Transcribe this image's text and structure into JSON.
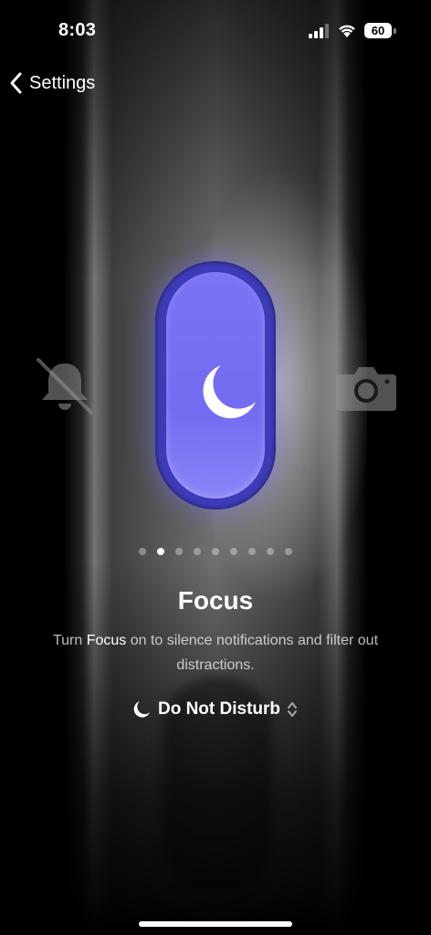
{
  "status_bar": {
    "time": "8:03",
    "battery_level": "60"
  },
  "nav": {
    "back_label": "Settings"
  },
  "action_button": {
    "left_icon": "bell-slash-icon",
    "center_icon": "moon-icon",
    "right_icon": "camera-icon",
    "accent_color": "#7a74f5"
  },
  "pager": {
    "count": 9,
    "active_index": 1
  },
  "content": {
    "title": "Focus",
    "description_prefix": "Turn ",
    "description_highlight": "Focus",
    "description_suffix": " on to silence notifications and filter out distractions."
  },
  "mode_selector": {
    "icon": "moon-icon",
    "label": "Do Not Disturb",
    "chevron_icon": "chevron-up-down-icon"
  }
}
